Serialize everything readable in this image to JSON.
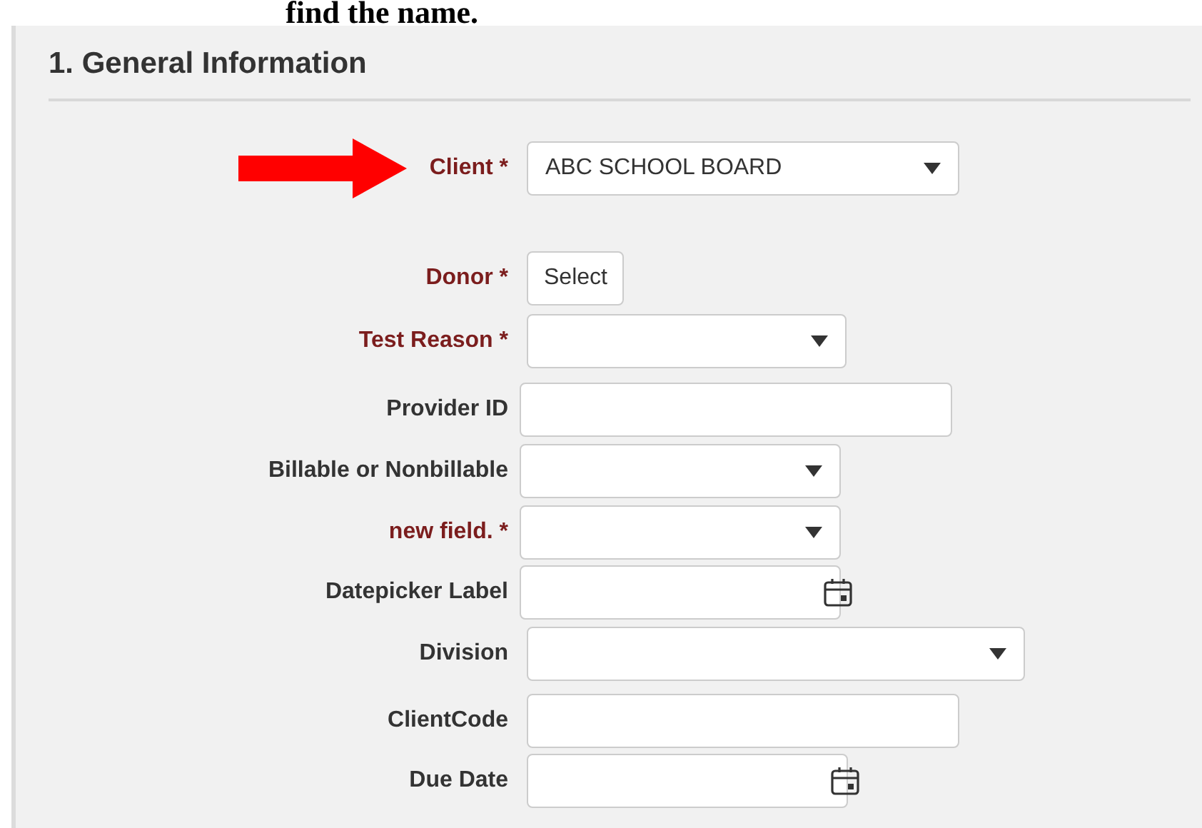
{
  "top_caption": "find the name.",
  "section": {
    "title": "1. General Information"
  },
  "fields": [
    {
      "label": "Client *",
      "required": true,
      "kind": "select",
      "value": "ABC SCHOOL BOARD",
      "pointed": true
    },
    {
      "label": "Donor *",
      "required": true,
      "kind": "button",
      "value": "Select",
      "pointed": false
    },
    {
      "label": "Test Reason *",
      "required": true,
      "kind": "select",
      "pointed": false
    },
    {
      "label": "Provider ID",
      "required": false,
      "kind": "text",
      "pointed": false
    },
    {
      "label": "Billable or Nonbillable",
      "required": false,
      "kind": "select",
      "pointed": false
    },
    {
      "label": "new field. *",
      "required": true,
      "kind": "select",
      "pointed": false
    },
    {
      "label": "Datepicker Label",
      "required": false,
      "kind": "date",
      "pointed": false
    },
    {
      "label": "Division",
      "required": false,
      "kind": "select",
      "pointed": false
    },
    {
      "label": "ClientCode",
      "required": false,
      "kind": "text",
      "pointed": false
    },
    {
      "label": "Due Date",
      "required": false,
      "kind": "date",
      "pointed": false
    }
  ]
}
